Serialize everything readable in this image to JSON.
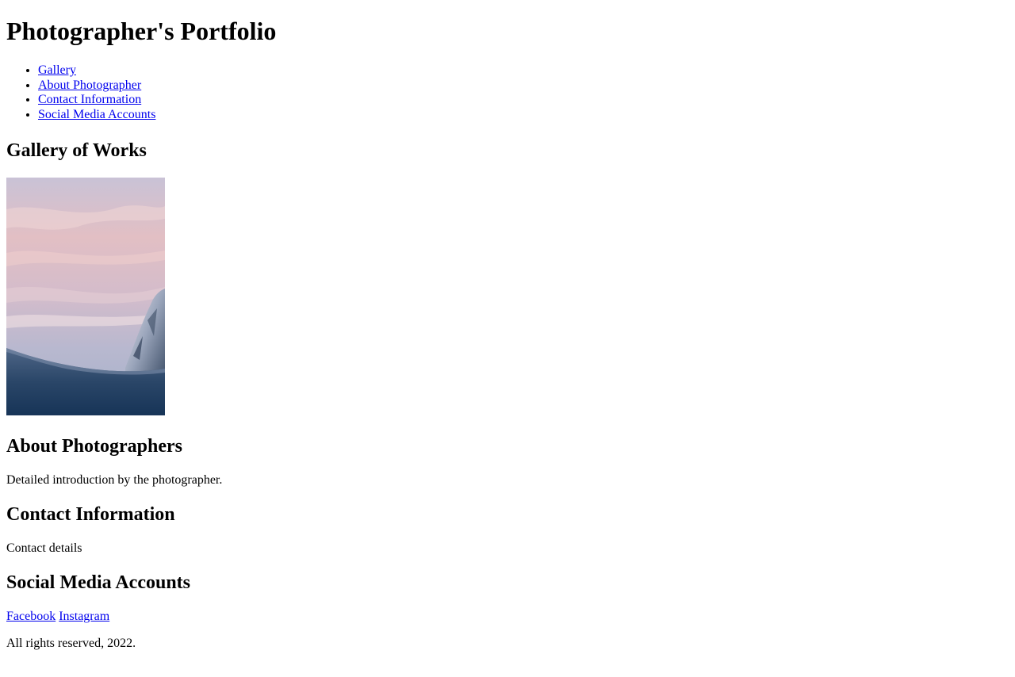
{
  "header": {
    "title": "Photographer's Portfolio"
  },
  "nav": {
    "items": [
      {
        "label": "Gallery"
      },
      {
        "label": "About Photographer"
      },
      {
        "label": "Contact Information"
      },
      {
        "label": "Social Media Accounts"
      }
    ]
  },
  "gallery": {
    "heading": "Gallery of Works",
    "photo_subject": "snowy-mountain-at-sunset",
    "colors": {
      "sky_top": "#d9b8c2",
      "sky_mid": "#c7b6cc",
      "sky_low": "#a9b3c8",
      "snow_dark": "#1e3b5e",
      "snow_light": "#5a6f8f"
    }
  },
  "about": {
    "heading": "About Photographers",
    "text": "Detailed introduction by the photographer."
  },
  "contact": {
    "heading": "Contact Information",
    "text": "Contact details"
  },
  "social": {
    "heading": "Social Media Accounts",
    "links": [
      {
        "label": "Facebook"
      },
      {
        "label": "Instagram"
      }
    ]
  },
  "footer": {
    "text": "All rights reserved, 2022."
  },
  "colors": {
    "link": "#0000ee",
    "text": "#000000",
    "background": "#ffffff"
  }
}
